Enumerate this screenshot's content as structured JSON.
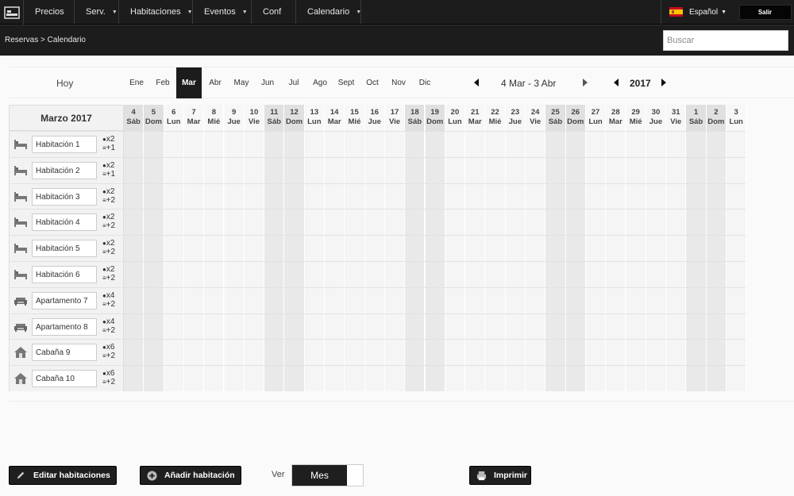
{
  "topnav": {
    "items": [
      {
        "label": "Precios",
        "dropdown": false
      },
      {
        "label": "Serv.",
        "dropdown": true
      },
      {
        "label": "Habitaciones",
        "dropdown": true
      },
      {
        "label": "Eventos",
        "dropdown": true
      },
      {
        "label": "Conf",
        "dropdown": false
      },
      {
        "label": "Calendario",
        "dropdown": true
      }
    ],
    "language": "Español",
    "logout": "Salir"
  },
  "subbar": {
    "breadcrumb": "Reservas > Calendario",
    "search_placeholder": "Buscar"
  },
  "monthbar": {
    "today": "Hoy",
    "months": [
      "Ene",
      "Feb",
      "Mar",
      "Abr",
      "May",
      "Jun",
      "Jul",
      "Ago",
      "Sept",
      "Oct",
      "Nov",
      "Dic"
    ],
    "active_month": "Mar",
    "range": "4 Mar - 3 Abr",
    "year": "2017"
  },
  "calendar": {
    "header": "Marzo 2017",
    "days": [
      {
        "num": "4",
        "dow": "Sáb",
        "weekend": true
      },
      {
        "num": "5",
        "dow": "Dom",
        "weekend": true
      },
      {
        "num": "6",
        "dow": "Lun",
        "weekend": false
      },
      {
        "num": "7",
        "dow": "Mar",
        "weekend": false
      },
      {
        "num": "8",
        "dow": "Mié",
        "weekend": false
      },
      {
        "num": "9",
        "dow": "Jue",
        "weekend": false
      },
      {
        "num": "10",
        "dow": "Vie",
        "weekend": false
      },
      {
        "num": "11",
        "dow": "Sáb",
        "weekend": true
      },
      {
        "num": "12",
        "dow": "Dom",
        "weekend": true
      },
      {
        "num": "13",
        "dow": "Lun",
        "weekend": false
      },
      {
        "num": "14",
        "dow": "Mar",
        "weekend": false
      },
      {
        "num": "15",
        "dow": "Mié",
        "weekend": false
      },
      {
        "num": "16",
        "dow": "Jue",
        "weekend": false
      },
      {
        "num": "17",
        "dow": "Vie",
        "weekend": false
      },
      {
        "num": "18",
        "dow": "Sáb",
        "weekend": true
      },
      {
        "num": "19",
        "dow": "Dom",
        "weekend": true
      },
      {
        "num": "20",
        "dow": "Lun",
        "weekend": false
      },
      {
        "num": "21",
        "dow": "Mar",
        "weekend": false
      },
      {
        "num": "22",
        "dow": "Mié",
        "weekend": false
      },
      {
        "num": "23",
        "dow": "Jue",
        "weekend": false
      },
      {
        "num": "24",
        "dow": "Vie",
        "weekend": false
      },
      {
        "num": "25",
        "dow": "Sáb",
        "weekend": true
      },
      {
        "num": "26",
        "dow": "Dom",
        "weekend": true
      },
      {
        "num": "27",
        "dow": "Lun",
        "weekend": false
      },
      {
        "num": "28",
        "dow": "Mar",
        "weekend": false
      },
      {
        "num": "29",
        "dow": "Mié",
        "weekend": false
      },
      {
        "num": "30",
        "dow": "Jue",
        "weekend": false
      },
      {
        "num": "31",
        "dow": "Vie",
        "weekend": false
      },
      {
        "num": "1",
        "dow": "Sáb",
        "weekend": true
      },
      {
        "num": "2",
        "dow": "Dom",
        "weekend": true
      },
      {
        "num": "3",
        "dow": "Lun",
        "weekend": false
      }
    ],
    "rooms": [
      {
        "name": "Habitación 1",
        "icon": "bed-icon",
        "adults": "x2",
        "extra": "+1"
      },
      {
        "name": "Habitación 2",
        "icon": "bed-icon",
        "adults": "x2",
        "extra": "+1"
      },
      {
        "name": "Habitación 3",
        "icon": "bed-icon",
        "adults": "x2",
        "extra": "+2"
      },
      {
        "name": "Habitación 4",
        "icon": "bed-icon",
        "adults": "x2",
        "extra": "+2"
      },
      {
        "name": "Habitación 5",
        "icon": "bed-icon",
        "adults": "x2",
        "extra": "+2"
      },
      {
        "name": "Habitación 6",
        "icon": "bed-icon",
        "adults": "x2",
        "extra": "+2"
      },
      {
        "name": "Apartamento 7",
        "icon": "sofa-icon",
        "adults": "x4",
        "extra": "+2"
      },
      {
        "name": "Apartamento 8",
        "icon": "sofa-icon",
        "adults": "x4",
        "extra": "+2"
      },
      {
        "name": "Cabaña 9",
        "icon": "house-icon",
        "adults": "x6",
        "extra": "+2"
      },
      {
        "name": "Cabaña 10",
        "icon": "house-icon",
        "adults": "x6",
        "extra": "+2"
      }
    ]
  },
  "footer": {
    "edit_rooms": "Editar habitaciones",
    "add_room": "Añadir habitación",
    "view_label": "Ver",
    "view_value": "Mes",
    "print": "Imprimir"
  }
}
